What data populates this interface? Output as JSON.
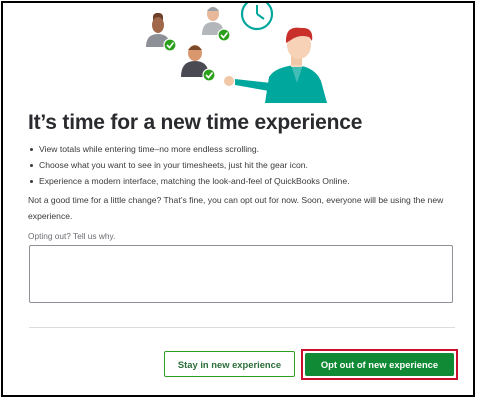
{
  "dialog": {
    "title": "It’s time for a new time experience",
    "bullets": [
      "View totals while entering time–no more endless scrolling.",
      "Choose what you want to see in your timesheets, just hit the gear icon.",
      "Experience a modern interface, matching the look-and-feel of QuickBooks Online."
    ],
    "paragraph": "Not a good time for a little change? That’s fine, you can opt out for now. Soon, everyone will be using the new experience.",
    "reason_label": "Opting out? Tell us why.",
    "reason_value": "",
    "stay_button": "Stay in new experience",
    "opt_out_button": "Opt out of new experience"
  },
  "illustration": {
    "icons": [
      "person-avatar-icon",
      "check-badge-icon",
      "clock-icon",
      "presenter-person-icon"
    ]
  },
  "colors": {
    "primary_green": "#108a34",
    "check_green": "#2ca01c",
    "teal": "#00a79d",
    "highlight_red": "#c8102e"
  }
}
